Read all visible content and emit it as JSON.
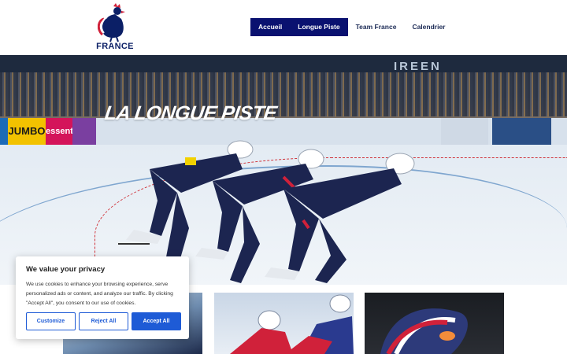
{
  "brand": {
    "name": "FRANCE",
    "logo_icon": "rooster-icon",
    "color": "#0b1f66",
    "accent": "#d0213a"
  },
  "nav": {
    "items": [
      {
        "label": "Accueil",
        "active": true
      },
      {
        "label": "Longue Piste",
        "active": true
      },
      {
        "label": "Team France",
        "active": false
      },
      {
        "label": "Calendrier",
        "active": false
      }
    ],
    "active_color": "#0a1170"
  },
  "hero": {
    "title": "LA LONGUE PISTE",
    "ads": [
      "JUMBO",
      "essent",
      "IREEN"
    ]
  },
  "cookie": {
    "title": "We value your privacy",
    "text": "We use cookies to enhance your browsing experience, serve personalized ads or content, and analyze our traffic. By clicking \"Accept All\", you consent to our use of cookies.",
    "customize_label": "Customize",
    "reject_label": "Reject All",
    "accept_label": "Accept All",
    "button_color": "#1e5bd6"
  }
}
